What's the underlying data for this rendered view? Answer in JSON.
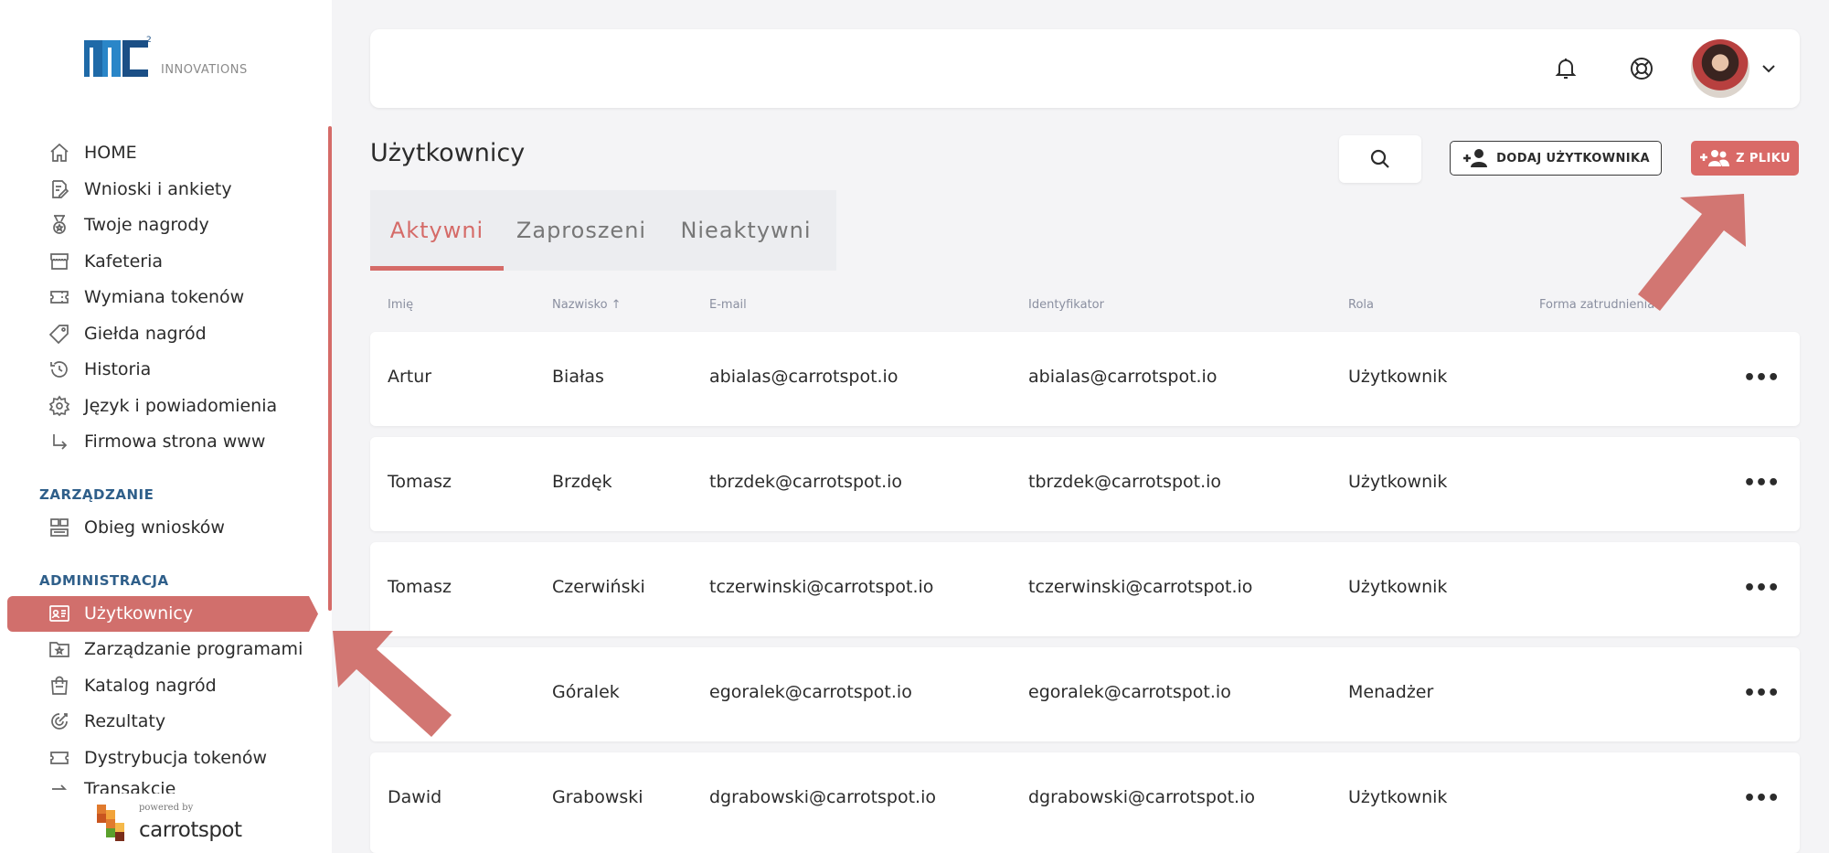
{
  "brand": {
    "logo_text": "INNOVATIONS",
    "logo_sup": "2",
    "powered_by": "powered by",
    "powered_name": "carrotspot"
  },
  "sidebar": {
    "items": [
      {
        "label": "HOME",
        "icon": "home-icon"
      },
      {
        "label": "Wnioski i ankiety",
        "icon": "document-edit-icon"
      },
      {
        "label": "Twoje nagrody",
        "icon": "medal-icon"
      },
      {
        "label": "Kafeteria",
        "icon": "store-icon"
      },
      {
        "label": "Wymiana tokenów",
        "icon": "ticket-icon"
      },
      {
        "label": "Giełda nagród",
        "icon": "tag-icon"
      },
      {
        "label": "Historia",
        "icon": "history-icon"
      },
      {
        "label": "Język i powiadomienia",
        "icon": "gear-icon"
      },
      {
        "label": "Firmowa strona www",
        "icon": "arrow-down-right-icon"
      }
    ],
    "section_management": "ZARZĄDZANIE",
    "management_items": [
      {
        "label": "Obieg wniosków",
        "icon": "workflow-icon"
      }
    ],
    "section_admin": "ADMINISTRACJA",
    "admin_items": [
      {
        "label": "Użytkownicy",
        "icon": "id-card-icon",
        "active": true
      },
      {
        "label": "Zarządzanie programami",
        "icon": "folder-star-icon"
      },
      {
        "label": "Katalog nagród",
        "icon": "shopping-bag-icon"
      },
      {
        "label": "Rezultaty",
        "icon": "target-icon"
      },
      {
        "label": "Dystrybucja tokenów",
        "icon": "ticket-icon"
      },
      {
        "label": "Transakcje",
        "icon": "transfer-icon"
      }
    ]
  },
  "topbar": {
    "icons": [
      "bell-icon",
      "lifebuoy-icon",
      "avatar",
      "chevron-down-icon"
    ]
  },
  "page": {
    "title": "Użytkownicy",
    "add_user_label": "DODAJ UŻYTKOWNIKA",
    "from_file_label": "Z PLIKU"
  },
  "tabs": [
    {
      "label": "Aktywni",
      "active": true
    },
    {
      "label": "Zaproszeni",
      "active": false
    },
    {
      "label": "Nieaktywni",
      "active": false
    }
  ],
  "table": {
    "headers": {
      "first_name": "Imię",
      "last_name": "Nazwisko ↑",
      "email": "E-mail",
      "identifier": "Identyfikator",
      "role": "Rola",
      "employment": "Forma zatrudnienia"
    },
    "rows": [
      {
        "first_name": "Artur",
        "last_name": "Białas",
        "email": "abialas@carrotspot.io",
        "identifier": "abialas@carrotspot.io",
        "role": "Użytkownik",
        "actions": "•••"
      },
      {
        "first_name": "Tomasz",
        "last_name": "Brzdęk",
        "email": "tbrzdek@carrotspot.io",
        "identifier": "tbrzdek@carrotspot.io",
        "role": "Użytkownik",
        "actions": "•••"
      },
      {
        "first_name": "Tomasz",
        "last_name": "Czerwiński",
        "email": "tczerwinski@carrotspot.io",
        "identifier": "tczerwinski@carrotspot.io",
        "role": "Użytkownik",
        "actions": "•••"
      },
      {
        "first_name": "",
        "last_name": "Góralek",
        "email": "egoralek@carrotspot.io",
        "identifier": "egoralek@carrotspot.io",
        "role": "Menadżer",
        "actions": "•••"
      },
      {
        "first_name": "Dawid",
        "last_name": "Grabowski",
        "email": "dgrabowski@carrotspot.io",
        "identifier": "dgrabowski@carrotspot.io",
        "role": "Użytkownik",
        "actions": "•••"
      }
    ]
  },
  "colors": {
    "accent": "#d56b68",
    "section_heading": "#2f5f8a",
    "annotation_arrow": "#d27672"
  }
}
